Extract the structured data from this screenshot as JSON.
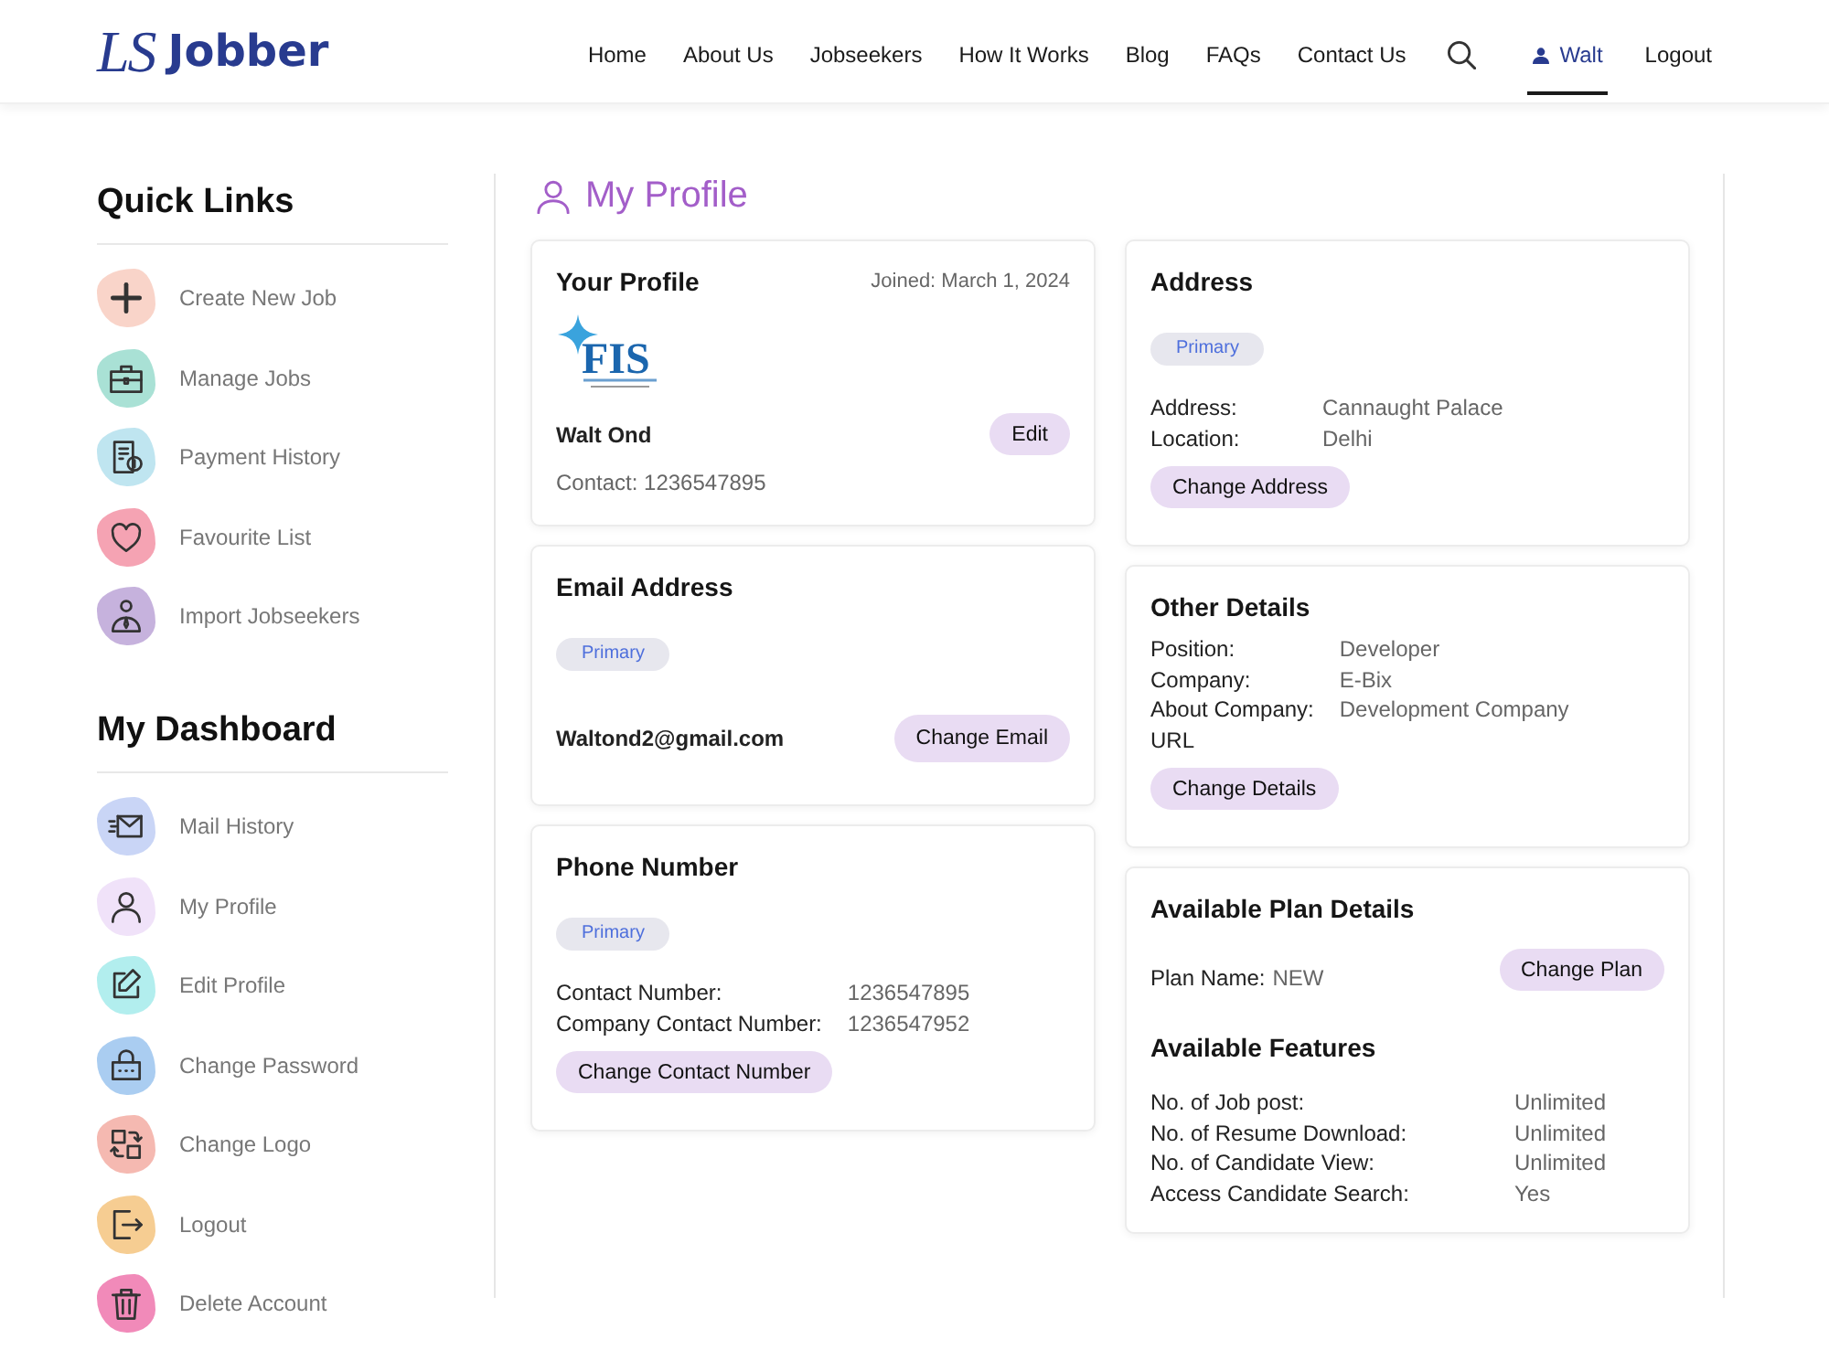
{
  "header": {
    "logo": {
      "mark": "LS",
      "name": "Jobber"
    },
    "nav": [
      {
        "kind": "link",
        "label": "Home",
        "selected": false
      },
      {
        "kind": "link",
        "label": "About Us",
        "selected": false
      },
      {
        "kind": "link",
        "label": "Jobseekers",
        "selected": false
      },
      {
        "kind": "link",
        "label": "How It Works",
        "selected": false
      },
      {
        "kind": "link",
        "label": "Blog",
        "selected": false
      },
      {
        "kind": "link",
        "label": "FAQs",
        "selected": false
      },
      {
        "kind": "link",
        "label": "Contact Us",
        "selected": false
      },
      {
        "kind": "search"
      },
      {
        "kind": "user",
        "label": "Walt",
        "selected": true
      },
      {
        "kind": "link",
        "label": "Logout",
        "selected": false
      }
    ]
  },
  "sidebar": {
    "sections": [
      {
        "title": "Quick Links",
        "items": [
          {
            "label": "Create New Job",
            "color": "#f9d4c9"
          },
          {
            "label": "Manage Jobs",
            "color": "#a9e1d5"
          },
          {
            "label": "Payment History",
            "color": "#bfe5f0"
          },
          {
            "label": "Favourite List",
            "color": "#f5a3b3"
          },
          {
            "label": "Import Jobseekers",
            "color": "#c6b2dd"
          }
        ]
      },
      {
        "title": "My Dashboard",
        "items": [
          {
            "label": "Mail History",
            "color": "#c9d5f6"
          },
          {
            "label": "My Profile",
            "color": "#f0e2f9"
          },
          {
            "label": "Edit Profile",
            "color": "#b2eeee"
          },
          {
            "label": "Change Password",
            "color": "#aacdf1"
          },
          {
            "label": "Change Logo",
            "color": "#f5b9b1"
          },
          {
            "label": "Logout",
            "color": "#f6cd92"
          },
          {
            "label": "Delete Account",
            "color": "#f18ab9"
          }
        ]
      }
    ]
  },
  "page_title": "My Profile",
  "columns": [
    {
      "cards": [
        {
          "kind": "profile",
          "title": "Your Profile",
          "joined": "Joined: March 1, 2024",
          "logo_text": "FIS",
          "name": "Walt Ond",
          "button": "Edit",
          "contact": "Contact: 1236547895"
        },
        {
          "kind": "email",
          "title": "Email Address",
          "badge": "Primary",
          "email": "Waltond2@gmail.com",
          "button": "Change Email"
        },
        {
          "kind": "details",
          "title": "Phone Number",
          "badge": "Primary",
          "rows": [
            {
              "label": "Contact Number:",
              "value": "1236547895"
            },
            {
              "label": "Company Contact Number:",
              "value": "1236547952"
            }
          ],
          "button": "Change Contact Number"
        }
      ]
    },
    {
      "cards": [
        {
          "kind": "details",
          "title": "Address",
          "badge": "Primary",
          "rows": [
            {
              "label": "Address:",
              "value": "Cannaught Palace"
            },
            {
              "label": "Location:",
              "value": "Delhi"
            }
          ],
          "button": "Change Address"
        },
        {
          "kind": "details",
          "title": "Other Details",
          "rows": [
            {
              "label": "Position:",
              "value": "Developer"
            },
            {
              "label": "Company:",
              "value": "E-Bix"
            },
            {
              "label": "About Company:",
              "value": "Development Company"
            },
            {
              "label": "URL"
            }
          ],
          "button": "Change Details"
        },
        {
          "kind": "plan",
          "title": "Available Plan Details",
          "plan_label": "Plan Name:",
          "plan_value": "NEW",
          "button": "Change Plan",
          "subtitle": "Available Features",
          "rows": [
            {
              "label": "No. of Job post:",
              "value": "Unlimited"
            },
            {
              "label": "No. of Resume Download:",
              "value": "Unlimited"
            },
            {
              "label": "No. of Candidate View:",
              "value": "Unlimited"
            },
            {
              "label": "Access Candidate Search:",
              "value": "Yes"
            }
          ]
        }
      ]
    }
  ]
}
